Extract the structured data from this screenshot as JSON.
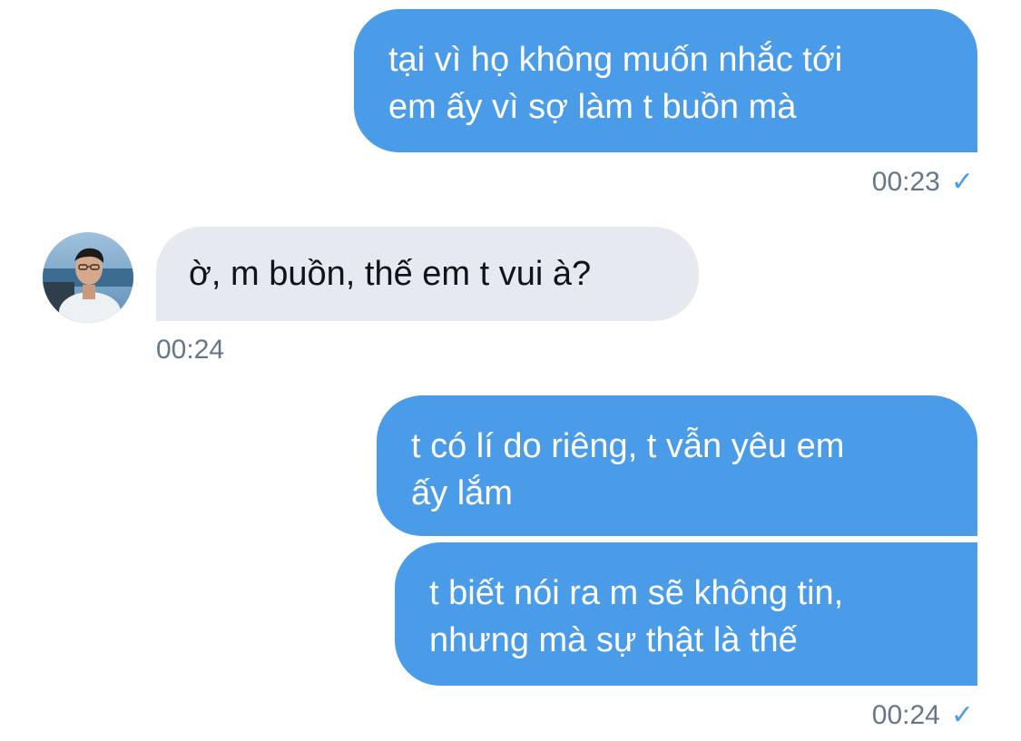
{
  "colors": {
    "sent_bubble": "#4a9ce8",
    "received_bubble": "#e6e9ef",
    "timestamp": "#657786",
    "read_check": "#4a9ce8"
  },
  "messages": [
    {
      "direction": "sent",
      "lines": [
        "tại vì họ không muốn nhắc tới",
        "em ấy vì sợ làm t buồn mà"
      ]
    },
    {
      "direction": "received",
      "lines": [
        "ờ, m buồn, thế em t vui à?"
      ]
    },
    {
      "direction": "sent",
      "lines": [
        "t có lí do riêng, t vẫn yêu em",
        "ấy lắm"
      ]
    },
    {
      "direction": "sent",
      "lines": [
        "t biết nói ra m sẽ không tin,",
        "nhưng mà sự thật là thế"
      ]
    }
  ],
  "timestamps": [
    "00:23",
    "00:24",
    "00:24"
  ],
  "read_check_icon": "✓",
  "avatar": {
    "icon": "user-avatar-photo"
  }
}
